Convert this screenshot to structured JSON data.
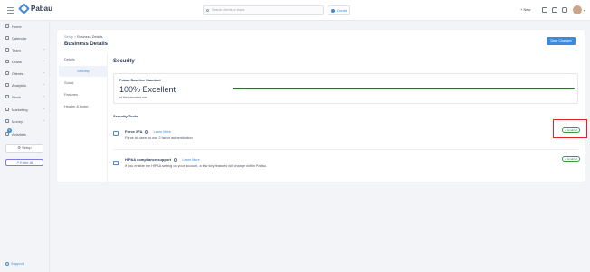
{
  "app": {
    "name": "Pabau",
    "brand_color": "#3d8bd9"
  },
  "topbar": {
    "search_placeholder": "Search clients or leads",
    "create_label": "Create",
    "new_label": "+ New",
    "icons": [
      "calendar-icon",
      "bell-icon",
      "chat-icon"
    ]
  },
  "sidebar": {
    "items": [
      {
        "label": "Home",
        "icon": "home-icon",
        "expandable": false
      },
      {
        "label": "Calendar",
        "icon": "calendar-icon",
        "expandable": false
      },
      {
        "label": "Team",
        "icon": "team-icon",
        "expandable": true
      },
      {
        "label": "Leads",
        "icon": "leads-icon",
        "expandable": true
      },
      {
        "label": "Clients",
        "icon": "clients-icon",
        "expandable": true
      },
      {
        "label": "Analytics",
        "icon": "analytics-icon",
        "expandable": true
      },
      {
        "label": "Stock",
        "icon": "stock-icon",
        "expandable": true
      },
      {
        "label": "Marketing",
        "icon": "marketing-icon",
        "expandable": true
      },
      {
        "label": "Money",
        "icon": "money-icon",
        "expandable": true
      },
      {
        "label": "Activities",
        "icon": "activities-icon",
        "expandable": false
      }
    ],
    "activities_badge": "9",
    "setup_label": "Setup",
    "enter_ai_label": "Enter AI",
    "support_label": "Support"
  },
  "page": {
    "breadcrumb_root": "Setup",
    "breadcrumb_sep": ">",
    "breadcrumb_current": "Business Details",
    "title": "Business Details",
    "save_label": "Save Changes"
  },
  "subnav": {
    "items": [
      "Details",
      "Security",
      "Social",
      "Features",
      "Header & footer"
    ],
    "active": "Security"
  },
  "security": {
    "title": "Security",
    "standard": {
      "title": "Pabau Baseline Standard",
      "value": "100% Excellent",
      "subtitle": "of the standard met",
      "progress": 1.0,
      "progress_color": "#177d1f"
    },
    "tools_title": "Security Tools",
    "tools": [
      {
        "name": "Force 2FA",
        "learn_more": "Learn More",
        "description": "Force all users to use 2 factor authentication",
        "status": "✓ Enabled",
        "icon": "phone-icon"
      },
      {
        "name": "HIPAA compliance support",
        "learn_more": "Learn More",
        "description": "If you enable the HIPAA setting on your account, a few key features will change within Pabau.",
        "status": "✓ Enabled",
        "icon": "lock-icon"
      }
    ],
    "status_color": "#2f9a47",
    "highlight_color": "#e02424"
  }
}
